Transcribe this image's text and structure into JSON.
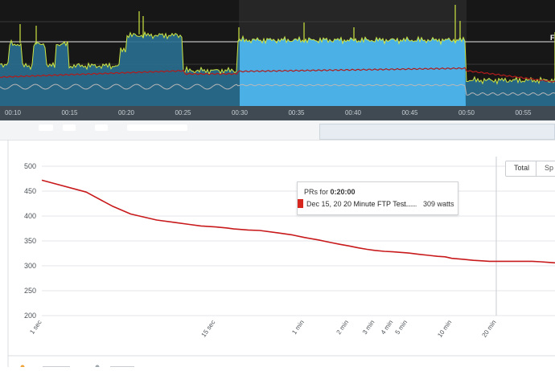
{
  "top_panel": {
    "time_labels": [
      "00:10",
      "00:15",
      "00:20",
      "00:25",
      "00:30",
      "00:35",
      "00:40",
      "00:45",
      "00:50",
      "00:55"
    ],
    "edge_label": "F",
    "colors": {
      "power": "#cde642",
      "fill": "#2a6f91",
      "highlight_fill": "#4ab0e6",
      "heart_rate": "#b01c1c",
      "cadence": "#b8b8b8"
    }
  },
  "tabs": {
    "total": "Total",
    "second": "Sp"
  },
  "tooltip": {
    "prefix": "PRs for",
    "duration": "0:20:00",
    "date": "Dec 15, 20",
    "name": "20 Minute FTP Test",
    "dots": "...........",
    "value": "309 watts",
    "swatch_color": "#d7261e"
  },
  "chart_data": {
    "type": "line",
    "title": "",
    "xlabel": "",
    "ylabel": "",
    "x_scale": "log",
    "ylim": [
      200,
      500
    ],
    "y_ticks": [
      500,
      450,
      400,
      350,
      300,
      250,
      200
    ],
    "x_ticks": [
      {
        "label": "1 sec",
        "seconds": 1
      },
      {
        "label": "15 sec",
        "seconds": 15
      },
      {
        "label": "1 min",
        "seconds": 60
      },
      {
        "label": "2 min",
        "seconds": 120
      },
      {
        "label": "3 min",
        "seconds": 180
      },
      {
        "label": "4 min",
        "seconds": 240
      },
      {
        "label": "5 min",
        "seconds": 300
      },
      {
        "label": "10 min",
        "seconds": 600
      },
      {
        "label": "20 min",
        "seconds": 1200
      }
    ],
    "grid": true,
    "crosshair_seconds": 1200,
    "line_color": "#c8191b",
    "series": [
      {
        "x": [
          1,
          2,
          3,
          4,
          6,
          8,
          10,
          12,
          15,
          18,
          20,
          25,
          30,
          40,
          50,
          60,
          75,
          90,
          105,
          120,
          140,
          160,
          180,
          210,
          240,
          270,
          300,
          360,
          420,
          480,
          540,
          600,
          720,
          840,
          960,
          1080,
          1200,
          1500,
          1800,
          2100,
          2400,
          2700,
          3000
        ],
        "y": [
          472,
          448,
          420,
          404,
          392,
          387,
          383,
          380,
          378,
          376,
          374,
          372,
          371,
          366,
          362,
          357,
          352,
          347,
          343,
          340,
          336,
          333,
          331,
          329,
          328,
          327,
          326,
          323,
          321,
          319,
          318,
          315,
          313,
          311,
          310,
          309,
          309,
          309,
          309,
          309,
          308,
          307,
          306
        ]
      }
    ]
  }
}
